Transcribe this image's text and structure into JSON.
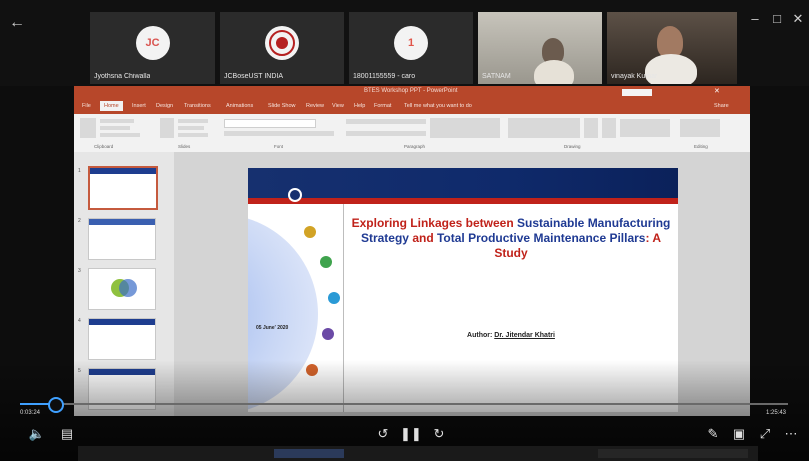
{
  "colors": {
    "ppt_accent": "#b7472a",
    "slide_navy": "#16306f",
    "slide_red": "#c0221a",
    "title_red": "#c0221a",
    "title_navy": "#1f3a93",
    "player_blue": "#3fa0ff"
  },
  "call": {
    "participants": [
      {
        "name": "Jyothsna Chiwalla",
        "initials": "JC",
        "type": "avatar"
      },
      {
        "name": "JCBoseUST INDIA",
        "initials": "",
        "type": "avatar-logo"
      },
      {
        "name": "18001155559 - caro",
        "initials": "1",
        "type": "avatar"
      },
      {
        "name": "SATNAM",
        "type": "video"
      },
      {
        "name": "vinayak Kumar",
        "type": "video"
      }
    ]
  },
  "ppt": {
    "window_title": "BTES Workshop PPT - PowerPoint",
    "tabs": [
      "File",
      "Home",
      "Insert",
      "Design",
      "Transitions",
      "Animations",
      "Slide Show",
      "Review",
      "View",
      "Help",
      "Format",
      "Tell me what you want to do",
      "Share"
    ],
    "selected_tab": "Home",
    "ribbon_groups": [
      "Clipboard",
      "Slides",
      "Font",
      "Paragraph",
      "Drawing",
      "Editing"
    ],
    "slide_numbers": [
      "1",
      "2",
      "3",
      "4",
      "5"
    ]
  },
  "slide": {
    "title_parts": [
      {
        "text": "Exploring Linkages between ",
        "color": "red"
      },
      {
        "text": "Sustainable Manufacturing Strategy ",
        "color": "navy"
      },
      {
        "text": "and ",
        "color": "red"
      },
      {
        "text": "Total Productive Maintenance Pillars",
        "color": "navy"
      },
      {
        "text": ": A Study",
        "color": "red"
      }
    ],
    "date": "05 June' 2020",
    "author_label": "Author: ",
    "author_name": "Dr. Jitendar Khatri"
  },
  "player": {
    "elapsed": "0:03:24",
    "total": "1:25:43",
    "progress_fraction": 0.045,
    "icons": [
      "volume-icon",
      "caption-icon",
      "play-icon",
      "pause-icon",
      "rewind-icon",
      "fullscreen-icon",
      "more-icon"
    ]
  }
}
